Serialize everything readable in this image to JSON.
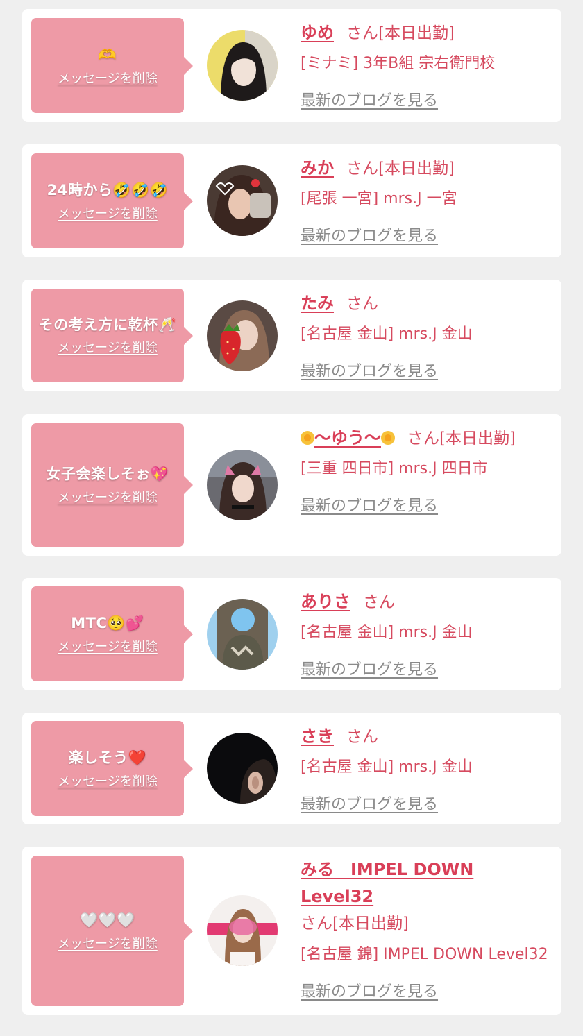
{
  "entries": [
    {
      "message": "🫶",
      "delete_label": "メッセージを削除",
      "name": "ゆめ",
      "suffix": "さん[本日出勤]",
      "shop": "[ミナミ] 3年B組 宗右衛門校",
      "blog_label": "最新のブログを見る"
    },
    {
      "message": "24時から🤣🤣🤣",
      "delete_label": "メッセージを削除",
      "name": "みか",
      "suffix": "さん[本日出勤]",
      "shop": "[尾張 一宮] mrs.J 一宮",
      "blog_label": "最新のブログを見る"
    },
    {
      "message": "その考え方に乾杯🥂",
      "delete_label": "メッセージを削除",
      "name": "たみ",
      "suffix": "さん",
      "shop": "[名古屋 金山] mrs.J 金山",
      "blog_label": "最新のブログを見る"
    },
    {
      "message": "女子会楽しそぉ💖",
      "delete_label": "メッセージを削除",
      "name": "〜ゆう〜",
      "suffix": "さん[本日出勤]",
      "shop": "[三重 四日市] mrs.J 四日市",
      "blog_label": "最新のブログを見る"
    },
    {
      "message": "MTC🥺💕",
      "delete_label": "メッセージを削除",
      "name": "ありさ",
      "suffix": "さん",
      "shop": "[名古屋 金山] mrs.J 金山",
      "blog_label": "最新のブログを見る"
    },
    {
      "message": "楽しそう❤️",
      "delete_label": "メッセージを削除",
      "name": "さき",
      "suffix": "さん",
      "shop": "[名古屋 金山] mrs.J 金山",
      "blog_label": "最新のブログを見る"
    },
    {
      "message": "🤍🤍🤍",
      "delete_label": "メッセージを削除",
      "name": "みる　IMPEL DOWN Level32",
      "suffix": "さん[本日出勤]",
      "shop": "[名古屋 錦] IMPEL DOWN Level32",
      "blog_label": "最新のブログを見る"
    }
  ],
  "colors": {
    "page_bg": "#efefef",
    "bubble": "#ee9aa6",
    "name": "#d93f58",
    "info": "#d64a5f",
    "blog_link": "#8a8a8a"
  }
}
